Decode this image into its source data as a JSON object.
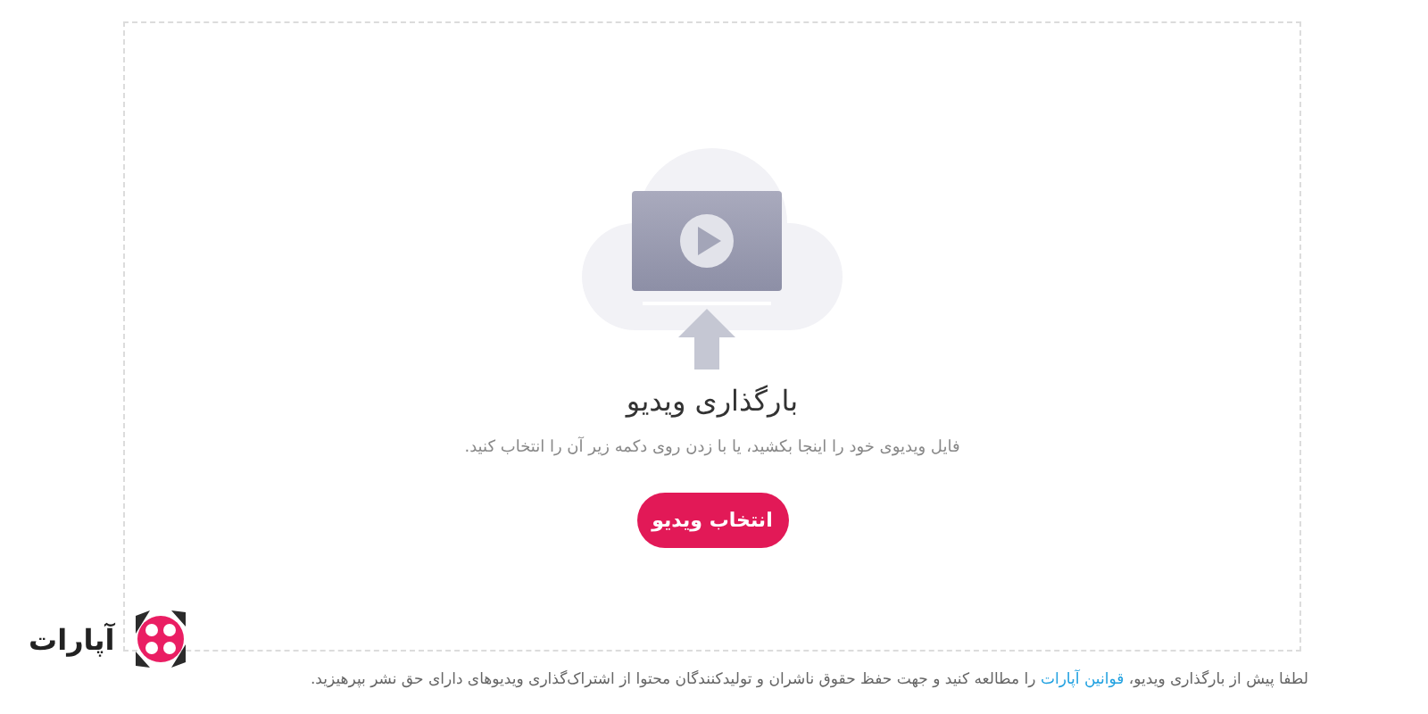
{
  "upload": {
    "title": "بارگذاری ویدیو",
    "hint": "فایل ویدیوی خود را اینجا بکشید، یا با زدن روی دکمه زیر آن را انتخاب کنید.",
    "button": "انتخاب ویدیو"
  },
  "notice": {
    "before": "لطفا پیش از بارگذاری ویدیو، ",
    "link": "قوانین آپارات",
    "after": " را مطالعه کنید و جهت حفظ حقوق ناشران و تولیدکنندگان محتوا از اشتراک‌گذاری ویدیوهای دارای حق نشر بپرهیزید."
  },
  "logo": {
    "text": "آپارات"
  }
}
